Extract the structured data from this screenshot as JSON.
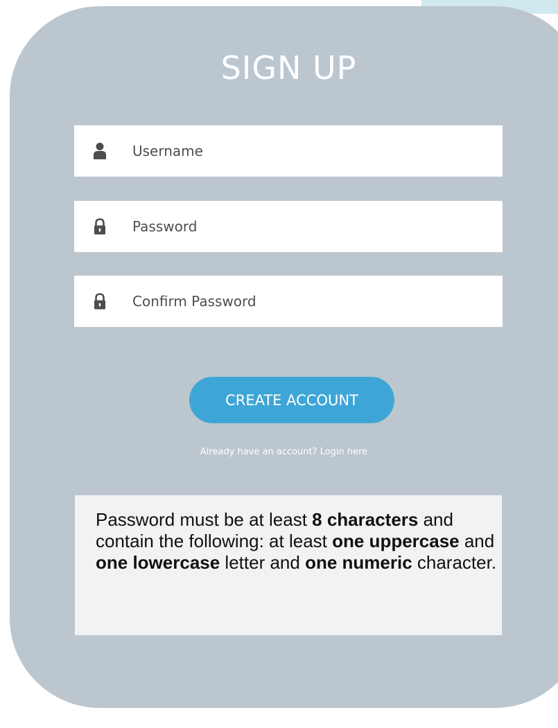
{
  "title": "SIGN UP",
  "fields": {
    "username": {
      "placeholder": "Username",
      "icon": "user-icon"
    },
    "password": {
      "placeholder": "Password",
      "icon": "lock-icon"
    },
    "confirm_password": {
      "placeholder": "Confirm Password",
      "icon": "lock-icon"
    }
  },
  "create_button_label": "CREATE ACCOUNT",
  "login_link_label": "Already have an account? Login here",
  "requirements": {
    "part1": "Password must be at least ",
    "bold1": "8 characters",
    "part2": " and contain the following: at least ",
    "bold2": "one uppercase",
    "part3": " and ",
    "bold3": "one lowercase",
    "part4": " letter and ",
    "bold4": "one numeric",
    "part5": " character."
  },
  "colors": {
    "card_background": "#bcc6cf",
    "button": "#3ea6d6",
    "info_box": "#f2f2f2",
    "corner_accent": "#cfe9ef"
  }
}
